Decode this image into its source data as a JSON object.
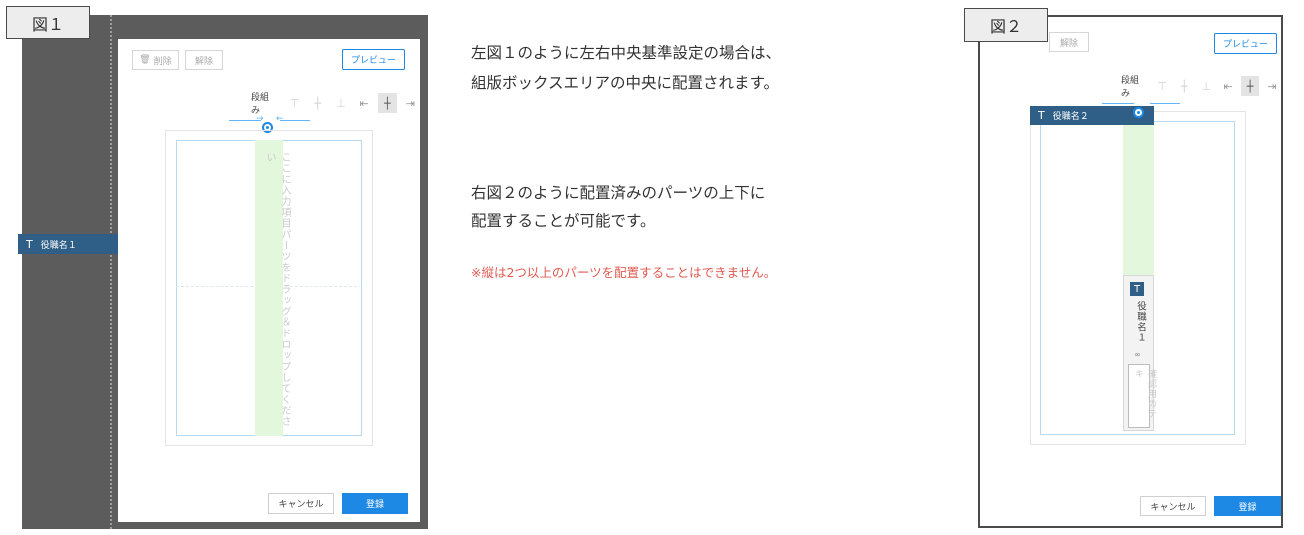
{
  "figure1": {
    "label": "図１",
    "toolbar": {
      "delete_label": "削除",
      "release_label": "解除",
      "preview_label": "プレビュー"
    },
    "layout_label": "段組み",
    "drop_hint": "ここに入力項目パーツをドラッグ＆ドロップしてください",
    "role_part": "役職名１",
    "cancel_label": "キャンセル",
    "register_label": "登録"
  },
  "description": {
    "line1": "左図１のように左右中央基準設定の場合は、",
    "line2": "組版ボックスエリアの中央に配置されます。",
    "line3": "右図２のように配置済みのパーツの上下に",
    "line4": "配置することが可能です。",
    "note": "※縦は2つ以上のパーツを配置することはできません。"
  },
  "figure2": {
    "label": "図２",
    "toolbar": {
      "release_label": "解除",
      "preview_label": "プレビュー"
    },
    "layout_label": "段組み",
    "role_part_top": "役職名２",
    "role_part_vertical": "役職名１",
    "sample_text": "確認用のテキ",
    "cancel_label": "キャンセル",
    "register_label": "登録"
  },
  "colors": {
    "accent": "#1e88e5",
    "part_bar": "#2f5f86",
    "drop_zone": "#e3f7dc",
    "note": "#e05a52"
  }
}
